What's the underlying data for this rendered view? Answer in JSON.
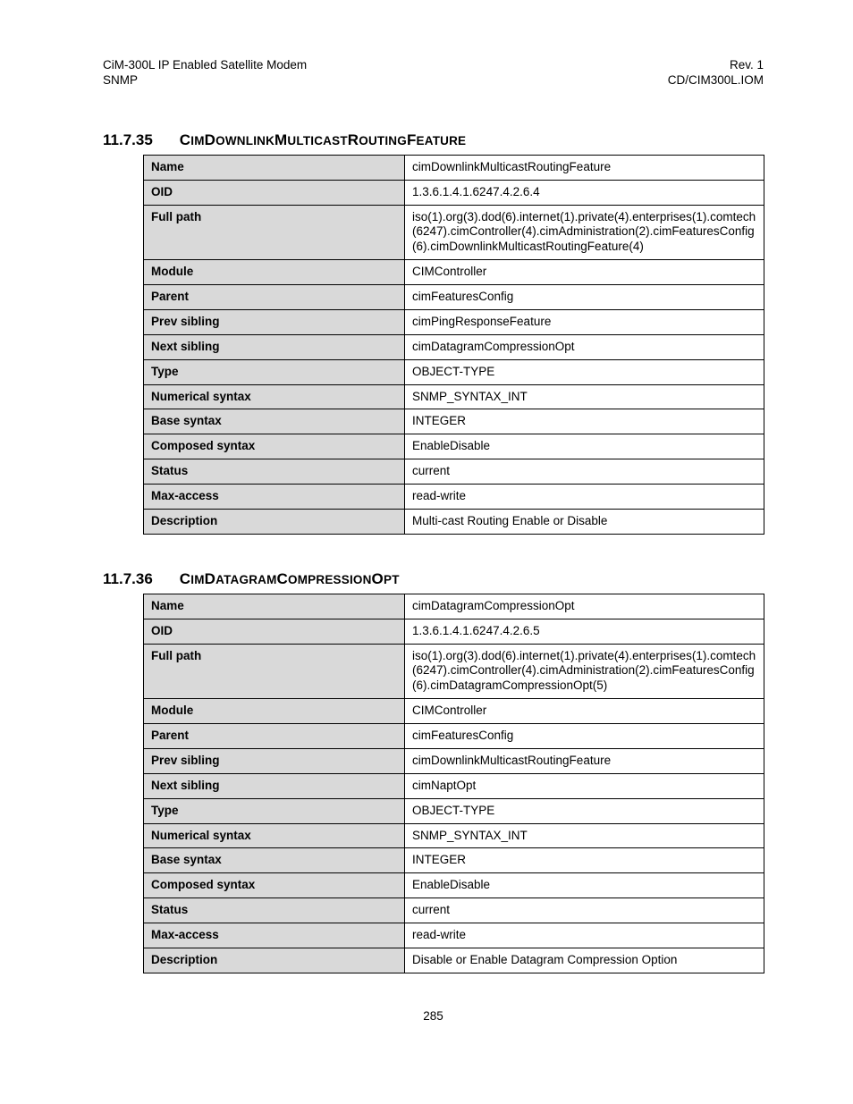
{
  "header": {
    "left1": "CiM-300L IP Enabled Satellite Modem",
    "left2": "SNMP",
    "right1": "Rev. 1",
    "right2": "CD/CIM300L.IOM"
  },
  "page_number": "285",
  "labels": {
    "Name": "Name",
    "OID": "OID",
    "FullPath": "Full path",
    "Module": "Module",
    "Parent": "Parent",
    "PrevSibling": "Prev sibling",
    "NextSibling": "Next sibling",
    "Type": "Type",
    "NumericalSyntax": "Numerical syntax",
    "BaseSyntax": "Base syntax",
    "ComposedSyntax": "Composed syntax",
    "Status": "Status",
    "MaxAccess": "Max-access",
    "Description": "Description"
  },
  "sections": [
    {
      "num": "11.7.35",
      "title_caps": [
        "C",
        "IM",
        "D",
        "OWNLINK",
        "M",
        "ULTICAST",
        "R",
        "OUTING",
        "F",
        "EATURE"
      ],
      "rows": {
        "Name": "cimDownlinkMulticastRoutingFeature",
        "OID": "1.3.6.1.4.1.6247.4.2.6.4",
        "FullPath": "iso(1).org(3).dod(6).internet(1).private(4).enterprises(1).comtech(6247).cimController(4).cimAdministration(2).cimFeaturesConfig(6).cimDownlinkMulticastRoutingFeature(4)",
        "Module": "CIMController",
        "Parent": "cimFeaturesConfig",
        "PrevSibling": "cimPingResponseFeature",
        "NextSibling": "cimDatagramCompressionOpt",
        "Type": "OBJECT-TYPE",
        "NumericalSyntax": "SNMP_SYNTAX_INT",
        "BaseSyntax": "INTEGER",
        "ComposedSyntax": "EnableDisable",
        "Status": "current",
        "MaxAccess": "read-write",
        "Description": "Multi-cast Routing Enable or Disable"
      }
    },
    {
      "num": "11.7.36",
      "title_caps": [
        "C",
        "IM",
        "D",
        "ATAGRAM",
        "C",
        "OMPRESSION",
        "O",
        "PT"
      ],
      "rows": {
        "Name": "cimDatagramCompressionOpt",
        "OID": "1.3.6.1.4.1.6247.4.2.6.5",
        "FullPath": "iso(1).org(3).dod(6).internet(1).private(4).enterprises(1).comtech(6247).cimController(4).cimAdministration(2).cimFeaturesConfig(6).cimDatagramCompressionOpt(5)",
        "Module": "CIMController",
        "Parent": "cimFeaturesConfig",
        "PrevSibling": "cimDownlinkMulticastRoutingFeature",
        "NextSibling": "cimNaptOpt",
        "Type": "OBJECT-TYPE",
        "NumericalSyntax": "SNMP_SYNTAX_INT",
        "BaseSyntax": "INTEGER",
        "ComposedSyntax": "EnableDisable",
        "Status": "current",
        "MaxAccess": "read-write",
        "Description": "Disable or Enable Datagram Compression Option"
      }
    }
  ]
}
